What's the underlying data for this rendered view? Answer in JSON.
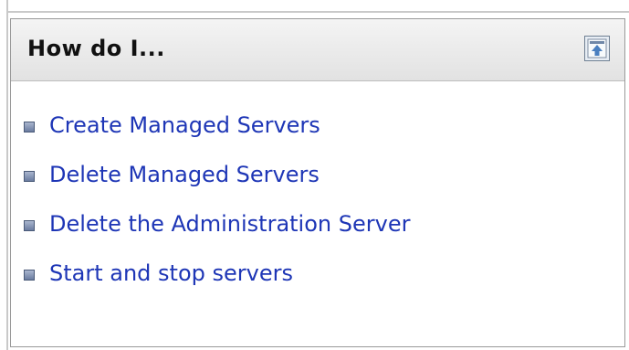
{
  "panel": {
    "title": "How do I...",
    "collapse_button_icon": "collapse-panel-icon",
    "link_color": "#1e36b6"
  },
  "items": [
    {
      "label": "Create Managed Servers",
      "icon": "bullet-square-icon"
    },
    {
      "label": "Delete Managed Servers",
      "icon": "bullet-square-icon"
    },
    {
      "label": "Delete the Administration Server",
      "icon": "bullet-square-icon"
    },
    {
      "label": "Start and stop servers",
      "icon": "bullet-square-icon"
    }
  ]
}
